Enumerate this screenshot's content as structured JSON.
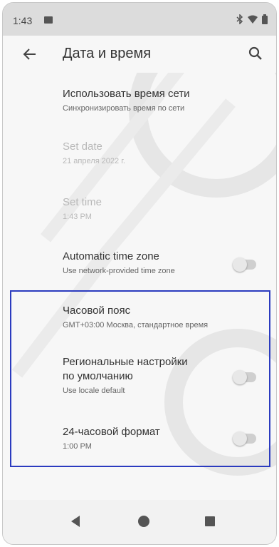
{
  "status_bar": {
    "time": "1:43"
  },
  "app_bar": {
    "title": "Дата и время"
  },
  "settings": [
    {
      "id": "use-network-time",
      "title": "Использовать время сети",
      "subtitle": "Синхронизировать время по сети",
      "enabled": true
    },
    {
      "id": "set-date",
      "title": "Set date",
      "subtitle": "21 апреля 2022 г.",
      "enabled": false
    },
    {
      "id": "set-time",
      "title": "Set time",
      "subtitle": "1:43 PM",
      "enabled": false
    },
    {
      "id": "automatic-time-zone",
      "title": "Automatic time zone",
      "subtitle": "Use network-provided time zone",
      "enabled": true,
      "toggle": false
    },
    {
      "id": "time-zone",
      "title": "Часовой пояс",
      "subtitle": "GMT+03:00 Москва, стандартное время",
      "enabled": true
    },
    {
      "id": "regional-defaults",
      "title_line1": "Региональные настройки",
      "title_line2": "по умолчанию",
      "subtitle": "Use locale default",
      "enabled": true,
      "toggle": false
    },
    {
      "id": "24-hour-format",
      "title": "24-часовой формат",
      "subtitle": "1:00 PM",
      "enabled": true,
      "toggle": false
    }
  ],
  "colors": {
    "highlight_border": "#2b3bbf",
    "status_bar_bg": "#dcdcdc",
    "screen_bg": "#f7f7f7"
  }
}
